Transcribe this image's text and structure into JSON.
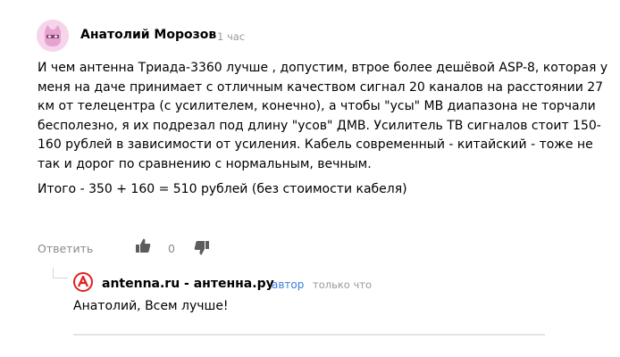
{
  "comment": {
    "author": "Анатолий Морозов",
    "time": "1 час",
    "avatar_icon": "cat-mask-icon",
    "avatar_bg": "#f6d4ea",
    "paragraphs": [
      "И чем антенна Триада-3360 лучше , допустим, втрое более дешёвой ASP-8, которая у меня на даче принимает с отличным качеством сигнал 20 каналов на расстоянии 27 км от телецентра (с усилителем, конечно), а чтобы \"усы\" МВ диапазона не торчали бесполезно, я их подрезал под длину \"усов\" ДМВ. Усилитель ТВ сигналов стоит 150-160 рублей в зависимости от усиления. Кабель современный - китайский - тоже не так и дорог по сравнению с нормальным, вечным.",
      "Итого - 350 + 160 = 510 рублей (без стоимости кабеля)"
    ],
    "actions": {
      "reply_label": "Ответить",
      "like_icon": "thumbs-up-icon",
      "vote_count": "0",
      "dislike_icon": "thumbs-down-icon"
    }
  },
  "reply": {
    "avatar_icon": "antenna-logo-icon",
    "avatar_color": "#e02020",
    "author": "antenna.ru - антенна.ру",
    "badge": "автор",
    "time": "только что",
    "text": "Анатолий, Всем лучше!"
  }
}
